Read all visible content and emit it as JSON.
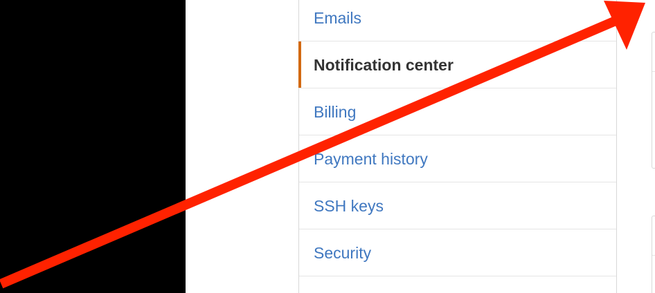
{
  "settings_menu": {
    "items": [
      {
        "label": "Emails",
        "selected": false
      },
      {
        "label": "Notification center",
        "selected": true
      },
      {
        "label": "Billing",
        "selected": false
      },
      {
        "label": "Payment history",
        "selected": false
      },
      {
        "label": "SSH keys",
        "selected": false
      },
      {
        "label": "Security",
        "selected": false
      }
    ]
  },
  "colors": {
    "link": "#4078c0",
    "selected_text": "#333333",
    "selected_marker": "#d26911",
    "annotation_arrow": "#ff2200",
    "left_panel": "#000000"
  },
  "icons": {
    "annotation": "red-arrow-annotation-icon"
  }
}
